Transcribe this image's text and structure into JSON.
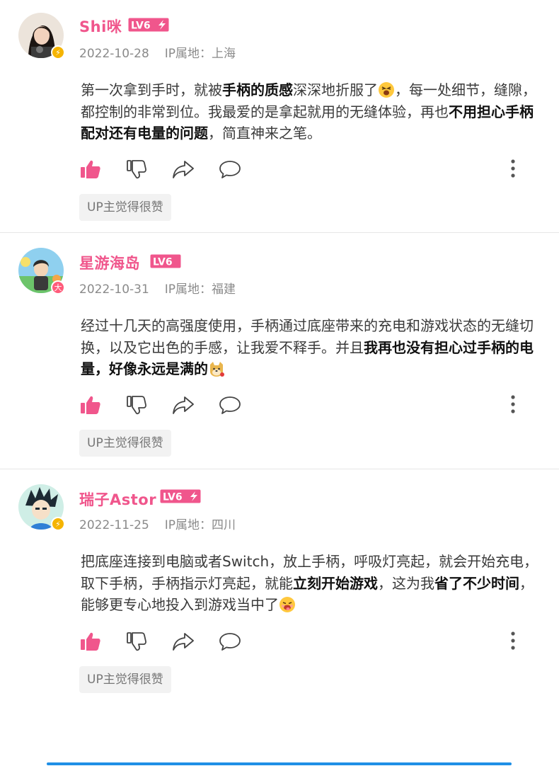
{
  "comments": [
    {
      "username": "Shi咪",
      "level": "LV6",
      "level_bolt": true,
      "date": "2022-10-28",
      "ip": "IP属地：上海",
      "avatar_badge": "bolt",
      "content": [
        {
          "t": "第一次拿到手时，就被"
        },
        {
          "t": "手柄的质感",
          "b": true
        },
        {
          "t": "深深地折服了"
        },
        {
          "emoji": "excited-emoji"
        },
        {
          "t": "，每一处细节，缝隙，都控制的非常到位。我最爱的是拿起就用的无缝体验，再也"
        },
        {
          "t": "不用担心手柄配对还有电量的问题",
          "b": true
        },
        {
          "t": "，简直神来之笔。"
        }
      ],
      "up_tag": "UP主觉得很赞"
    },
    {
      "username": "星游海岛",
      "level": "LV6",
      "level_bolt": false,
      "date": "2022-10-31",
      "ip": "IP属地：福建",
      "avatar_badge": "大",
      "content": [
        {
          "t": "经过十几天的高强度使用，手柄通过底座带来的充电和游戏状态的无缝切换，以及它出色的手感，让我爱不释手。并且"
        },
        {
          "t": "我再也没有担心过手柄的电量，好像永远是满的",
          "b": true
        },
        {
          "emoji": "doge-emoji"
        }
      ],
      "up_tag": "UP主觉得很赞"
    },
    {
      "username": "瑞子Astor",
      "level": "LV6",
      "level_bolt": true,
      "date": "2022-11-25",
      "ip": "IP属地：四川",
      "avatar_badge": "bolt",
      "content": [
        {
          "t": "把底座连接到电脑或者Switch，放上手柄，呼吸灯亮起，就会开始充电，取下手柄，手柄指示灯亮起，就能"
        },
        {
          "t": "立刻开始游戏",
          "b": true
        },
        {
          "t": "，这为我"
        },
        {
          "t": "省了不少时间",
          "b": true
        },
        {
          "t": "，能够更专心地投入到游戏当中了"
        },
        {
          "emoji": "drool-emoji"
        }
      ],
      "up_tag": "UP主觉得很赞"
    }
  ],
  "icons": {
    "like": "thumbs-up-icon",
    "dislike": "thumbs-down-icon",
    "share": "share-icon",
    "reply": "comment-bubble-icon",
    "more": "more-vertical-icon"
  },
  "colors": {
    "username": "#f0568c",
    "level_badge": "#f0568c",
    "like_active": "#f0568c",
    "scrollbar": "#1e8fe6"
  }
}
